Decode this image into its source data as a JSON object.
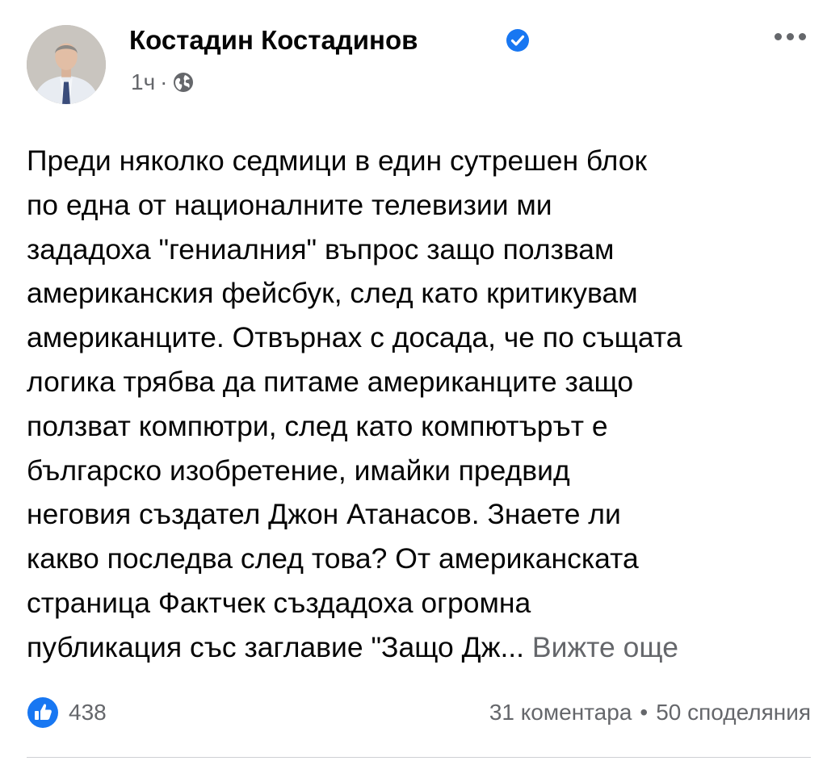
{
  "post": {
    "author": "Костадин Костадинов",
    "time": "1ч",
    "separator": "·",
    "text_lines": [
      "Преди няколко седмици в един сутрешен блок",
      "по една от националните телевизии ми",
      "зададоха \"гениалния\" въпрос защо ползвам",
      "американския фейсбук, след като критикувам",
      "американците. Отвърнах с досада, че по същата",
      "логика трябва да питаме американците защо",
      "ползват компютри, след като компютърът е",
      "българско изобретение, имайки предвид",
      "неговия създател Джон Атанасов. Знаете ли",
      "какво последва след това? От американската",
      "страница Фактчек създадоха огромна"
    ],
    "last_line": "публикация със заглавие \"Защо Дж...",
    "see_more": "Вижте още"
  },
  "reactions": {
    "like_count": "438",
    "comments": "31 коментара",
    "dot": "•",
    "shares": "50 споделяния"
  },
  "colors": {
    "text": "#050505",
    "secondary": "#65676b",
    "accent": "#1877f2"
  },
  "icons": [
    "verified-badge-icon",
    "globe-icon",
    "more-options-icon",
    "like-icon"
  ]
}
